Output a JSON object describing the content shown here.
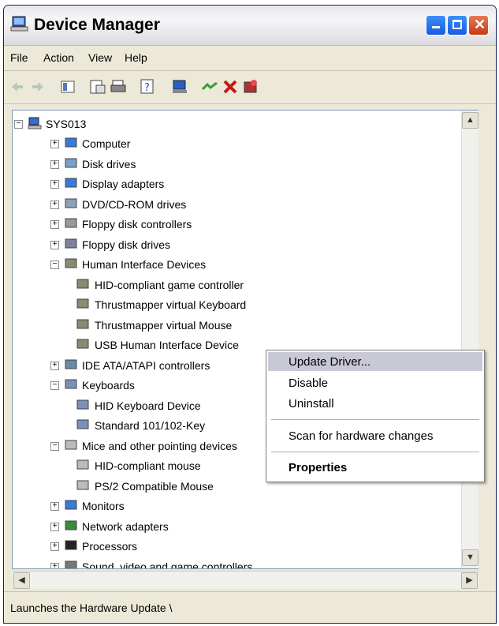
{
  "window": {
    "title": "Device Manager"
  },
  "menu": [
    "File",
    "Action",
    "View",
    "Help"
  ],
  "toolbar_icons": [
    "back-arrow-icon",
    "forward-arrow-icon",
    "console-tree-icon",
    "properties-icon",
    "print-icon",
    "help-icon",
    "scan-hardware-icon",
    "update-driver-icon",
    "uninstall-icon",
    "disable-icon"
  ],
  "tree": {
    "root": "SYS013",
    "items": [
      {
        "label": "Computer",
        "expander": "+"
      },
      {
        "label": "Disk drives",
        "expander": "+"
      },
      {
        "label": "Display adapters",
        "expander": "+"
      },
      {
        "label": "DVD/CD-ROM drives",
        "expander": "+"
      },
      {
        "label": "Floppy disk controllers",
        "expander": "+"
      },
      {
        "label": "Floppy disk drives",
        "expander": "+"
      },
      {
        "label": "Human Interface Devices",
        "expander": "−"
      },
      {
        "label": "HID-compliant game controller",
        "child": true
      },
      {
        "label": "Thrustmapper virtual Keyboard",
        "child": true
      },
      {
        "label": "Thrustmapper virtual Mouse",
        "child": true
      },
      {
        "label": "USB Human Interface Device",
        "child": true
      },
      {
        "label": "IDE ATA/ATAPI controllers",
        "expander": "+"
      },
      {
        "label": "Keyboards",
        "expander": "−"
      },
      {
        "label": "HID Keyboard Device",
        "child": true
      },
      {
        "label": "Standard 101/102-Key",
        "child": true
      },
      {
        "label": "Mice and other pointing devices",
        "expander": "−"
      },
      {
        "label": "HID-compliant mouse",
        "child": true
      },
      {
        "label": "PS/2 Compatible Mouse",
        "child": true
      },
      {
        "label": "Monitors",
        "expander": "+"
      },
      {
        "label": "Network adapters",
        "expander": "+"
      },
      {
        "label": "Processors",
        "expander": "+"
      },
      {
        "label": "Sound, video and game controllers",
        "expander": "+"
      }
    ]
  },
  "context_menu": {
    "update_driver": "Update Driver...",
    "disable": "Disable",
    "uninstall": "Uninstall",
    "scan": "Scan for hardware changes",
    "properties": "Properties"
  },
  "status": {
    "text": "Launches the Hardware Update \\"
  },
  "colors": {
    "selection": "#c9c9d6",
    "title_close": "#c53a14",
    "title_buttons": "#1a5be0"
  }
}
